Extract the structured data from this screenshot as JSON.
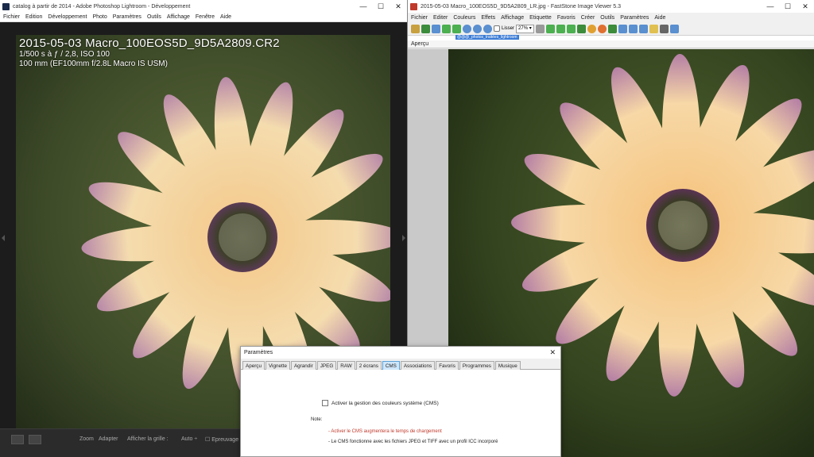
{
  "lightroom": {
    "title": "catalog à partir de 2014 - Adobe Photoshop Lightroom - Développement",
    "menu": [
      "Fichier",
      "Edition",
      "Développement",
      "Photo",
      "Paramètres",
      "Outils",
      "Affichage",
      "Fenêtre",
      "Aide"
    ],
    "info": {
      "filename": "2015-05-03 Macro_100EOS5D_9D5A2809.CR2",
      "exposure": "1/500 s à ƒ / 2,8, ISO 100",
      "lens": "100 mm (EF100mm f/2.8L Macro IS USM)"
    },
    "toolbar": {
      "zoom": "Zoom",
      "fit": "Adapter",
      "grid": "Afficher la grille :",
      "auto": "Auto ÷",
      "proof": "Epreuvage"
    }
  },
  "faststone": {
    "title": "2015-05-03 Macro_100EOS5D_9D5A2809_LR.jpg - FastStone Image Viewer 5.3",
    "menu": [
      "Fichier",
      "Editer",
      "Couleurs",
      "Effets",
      "Affichage",
      "Etiquette",
      "Favoris",
      "Créer",
      "Outils",
      "Paramètres",
      "Aide"
    ],
    "smooth_label": "Lisser",
    "zoom_value": "27%",
    "path": "@@@_photos_traitées_lightroom",
    "preview_label": "Aperçu"
  },
  "dialog": {
    "title": "Paramètres",
    "tabs": [
      "Aperçu",
      "Vignette",
      "Agrandir",
      "JPEG",
      "RAW",
      "2 écrans",
      "CMS",
      "Associations",
      "Favoris",
      "Programmes",
      "Musique"
    ],
    "active_tab": "CMS",
    "checkbox_label": "Activer la gestion des couleurs système (CMS)",
    "note_label": "Note:",
    "note_1": "- Activer le CMS augmentera le temps de chargement",
    "note_2": "- Le CMS fonctionne avec les fichiers JPEG et TIFF avec un profil ICC incorporé"
  },
  "colors": {
    "lr_icon": "#1a2a4a",
    "fs_icon": "#c0392b",
    "active_tab": "#cfe6fa",
    "note_warning": "#c0392b",
    "path_highlight": "#3a7bd5"
  }
}
